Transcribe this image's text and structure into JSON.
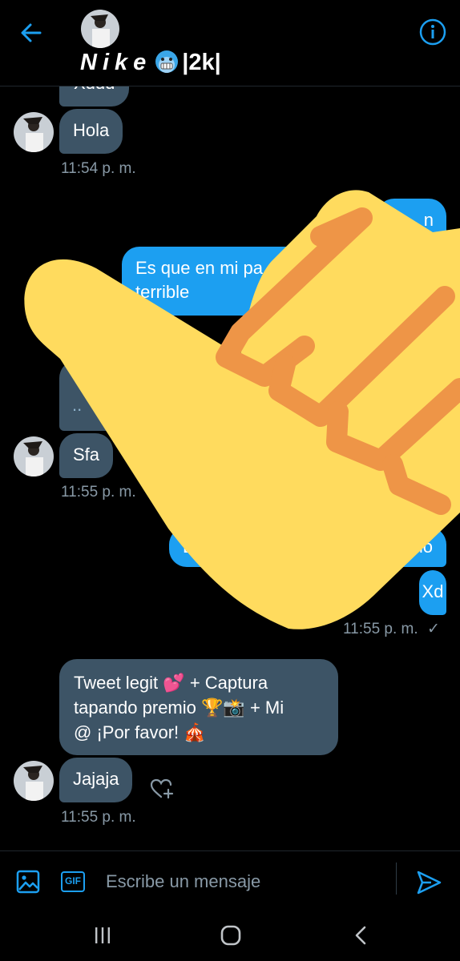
{
  "header": {
    "name": "Nike",
    "emoji": "cold-face-emoji",
    "suffix": "|2k|",
    "accent": "#1c9ff1"
  },
  "messages": {
    "partial_top": "Xddd",
    "m1": {
      "text": "Hola",
      "time": "11:54 p. m."
    },
    "m2_partial": "n",
    "m3": {
      "line1": "Es que en mi pa",
      "line2": "terrible"
    },
    "m4_partial": "..",
    "m5": {
      "text": "Sfa",
      "time": "11:55 p. m."
    },
    "m6": {
      "left": "Es",
      "right": "mo"
    },
    "m7": {
      "text": "Xd",
      "time": "11:55 p. m."
    },
    "m8": {
      "l1a": "Tweet legit",
      "l1b": "+ Captura",
      "l2a": "tapando premio",
      "l2b": "+ Mi",
      "l3": "@ ¡Por favor!"
    },
    "m9": {
      "text": "Jajaja",
      "time": "11:55 p. m."
    }
  },
  "composer": {
    "placeholder": "Escribe un mensaje",
    "gif_label": "GIF"
  },
  "colors": {
    "incoming": "#3d5466",
    "outgoing": "#1c9ff1",
    "timestamp": "#8899a6",
    "overlay_hand": "#ffdb5e"
  }
}
